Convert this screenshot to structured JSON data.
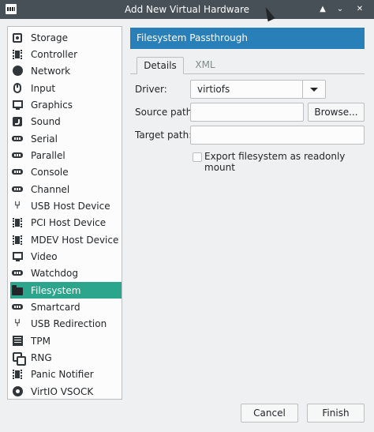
{
  "window": {
    "title": "Add New Virtual Hardware"
  },
  "sidebar": {
    "items": [
      {
        "label": "Storage",
        "icon": "storage-icon"
      },
      {
        "label": "Controller",
        "icon": "controller-icon"
      },
      {
        "label": "Network",
        "icon": "network-icon"
      },
      {
        "label": "Input",
        "icon": "mouse-icon"
      },
      {
        "label": "Graphics",
        "icon": "monitor-icon"
      },
      {
        "label": "Sound",
        "icon": "sound-icon"
      },
      {
        "label": "Serial",
        "icon": "serial-port-icon"
      },
      {
        "label": "Parallel",
        "icon": "parallel-port-icon"
      },
      {
        "label": "Console",
        "icon": "console-port-icon"
      },
      {
        "label": "Channel",
        "icon": "channel-port-icon"
      },
      {
        "label": "USB Host Device",
        "icon": "usb-icon"
      },
      {
        "label": "PCI Host Device",
        "icon": "pci-icon"
      },
      {
        "label": "MDEV Host Device",
        "icon": "mdev-icon"
      },
      {
        "label": "Video",
        "icon": "video-icon"
      },
      {
        "label": "Watchdog",
        "icon": "watchdog-icon"
      },
      {
        "label": "Filesystem",
        "icon": "folder-icon",
        "selected": true
      },
      {
        "label": "Smartcard",
        "icon": "smartcard-icon"
      },
      {
        "label": "USB Redirection",
        "icon": "usb-redirection-icon"
      },
      {
        "label": "TPM",
        "icon": "tpm-icon"
      },
      {
        "label": "RNG",
        "icon": "rng-icon"
      },
      {
        "label": "Panic Notifier",
        "icon": "panic-notifier-icon"
      },
      {
        "label": "VirtIO VSOCK",
        "icon": "vsock-icon"
      }
    ]
  },
  "content": {
    "header": "Filesystem Passthrough",
    "tabs": [
      {
        "label": "Details",
        "active": true
      },
      {
        "label": "XML",
        "active": false
      }
    ],
    "form": {
      "driver_label": "Driver:",
      "driver_value": "virtiofs",
      "source_label": "Source path:",
      "source_value": "",
      "browse_label": "Browse...",
      "target_label": "Target path:",
      "target_value": "",
      "readonly_label": "Export filesystem as readonly mount",
      "readonly_checked": false
    }
  },
  "footer": {
    "cancel_label": "Cancel",
    "finish_label": "Finish"
  },
  "colors": {
    "selection": "#2ca58d",
    "header": "#2980b9",
    "titlebar": "#475057"
  }
}
